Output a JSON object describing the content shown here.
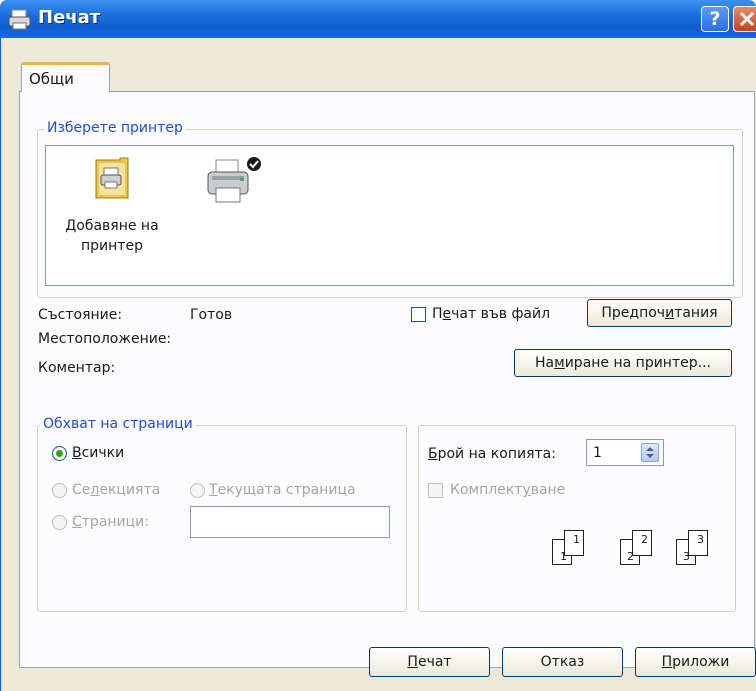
{
  "window": {
    "title": "Печат"
  },
  "tabs": [
    {
      "label": "Общи"
    }
  ],
  "printer_group": {
    "legend": "Изберете принтер",
    "add_printer_line1": "Добавяне на",
    "add_printer_line2": "принтер"
  },
  "status": {
    "status_label": "Състояние:",
    "status_value": "Готов",
    "location_label": "Местоположение:",
    "comment_label": "Коментар:"
  },
  "print_to_file": {
    "pre": "П",
    "mnemonic": "е",
    "post": "чат във файл",
    "checked": false
  },
  "preferences_button": {
    "pre": "Предпоч",
    "mnemonic": "и",
    "post": "тания"
  },
  "find_printer_button": {
    "pre": "На",
    "mnemonic": "м",
    "post": "иране на принтер..."
  },
  "page_range": {
    "legend": "Обхват на страници",
    "all": {
      "mnemonic": "В",
      "post": "сички",
      "selected": true
    },
    "selection": {
      "pre": "Се",
      "mnemonic": "л",
      "post": "екцията"
    },
    "current_page": {
      "mnemonic": "Т",
      "post": "екущата страница"
    },
    "pages": {
      "mnemonic": "С",
      "post": "траници:",
      "value": ""
    }
  },
  "copies": {
    "label_mnemonic": "Б",
    "label_post": "рой на копията:",
    "value": "1",
    "collate": {
      "pre": "Комплект",
      "mnemonic": "у",
      "post": "ване",
      "checked": false
    },
    "collate_pages": [
      "1",
      "1",
      "2",
      "2",
      "3",
      "3"
    ]
  },
  "footer_buttons": {
    "print": {
      "mnemonic": "П",
      "post": "ечат"
    },
    "cancel": {
      "label": "Отказ"
    },
    "apply": {
      "mnemonic": "П",
      "post": "риложи"
    }
  }
}
